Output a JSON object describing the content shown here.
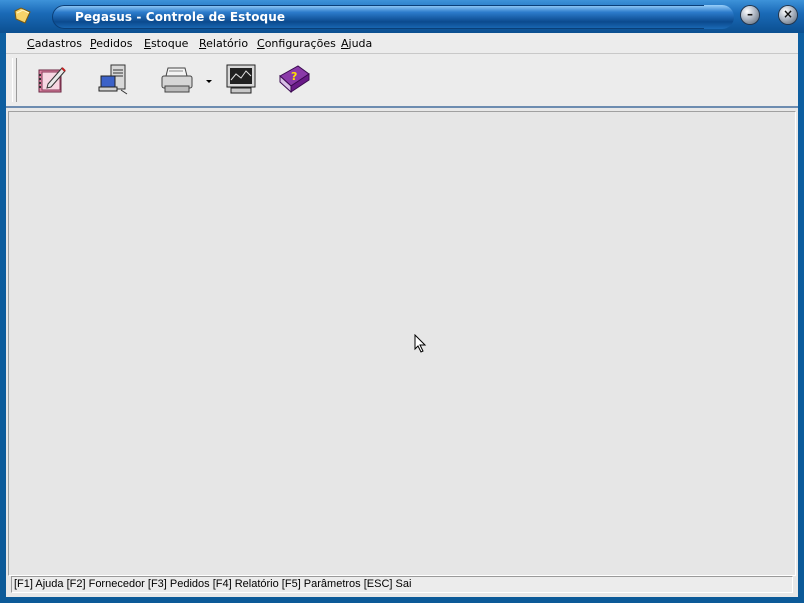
{
  "window": {
    "title": "Pegasus - Controle de Estoque",
    "accent": "#0c5a98"
  },
  "menu": {
    "items": [
      {
        "label_u": "C",
        "label_rest": "adastros"
      },
      {
        "label_u": "P",
        "label_rest": "edidos"
      },
      {
        "label_u": "E",
        "label_rest": "stoque"
      },
      {
        "label_u": "R",
        "label_rest": "elatório"
      },
      {
        "label_u": "C",
        "label_rest": "onfigurações"
      },
      {
        "label_u": "A",
        "label_rest": "juda"
      }
    ]
  },
  "toolbar": {
    "tools": [
      {
        "icon": "notebook-pen-icon"
      },
      {
        "icon": "computer-user-icon"
      },
      {
        "icon": "printer-icon"
      },
      {
        "icon": "monitor-chart-icon"
      },
      {
        "icon": "help-book-icon"
      }
    ]
  },
  "status": {
    "text": "[F1] Ajuda [F2] Fornecedor [F3] Pedidos [F4] Relatório [F5] Parâmetros [ESC] Sai"
  }
}
